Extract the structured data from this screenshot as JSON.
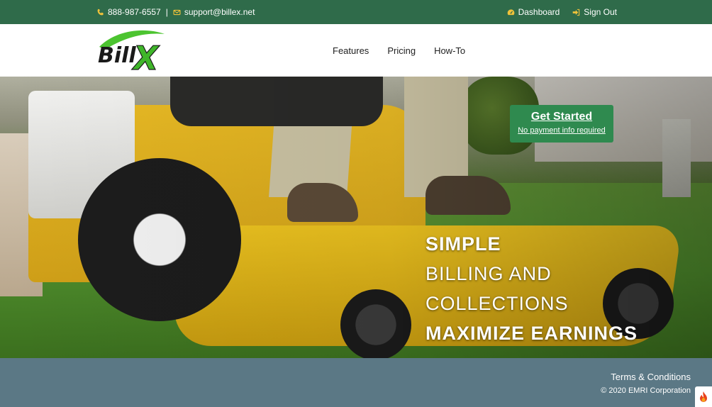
{
  "topbar": {
    "phone": "888-987-6557",
    "separator": "|",
    "email": "support@billex.net",
    "dashboard_label": "Dashboard",
    "signout_label": "Sign Out",
    "icons": [
      "phone-icon",
      "envelope-icon",
      "dashboard-gauge-icon",
      "sign-out-icon"
    ],
    "accent_color": "#f0c23a",
    "background_color": "#2f6b4a"
  },
  "navbar": {
    "logo_text": "BillX",
    "links": [
      {
        "label": "Features"
      },
      {
        "label": "Pricing"
      },
      {
        "label": "How-To"
      }
    ]
  },
  "hero": {
    "cta": {
      "title": "Get Started",
      "subtitle": "No payment info required",
      "color": "#2f8a4f"
    },
    "tagline": {
      "line1": "SIMPLE",
      "line2": "BILLING AND",
      "line3": "COLLECTIONS",
      "line4": "MAXIMIZE EARNINGS"
    }
  },
  "footer": {
    "terms_label": "Terms & Conditions",
    "copyright": "© 2020 EMRI Corporation",
    "background_color": "#5b7885"
  }
}
